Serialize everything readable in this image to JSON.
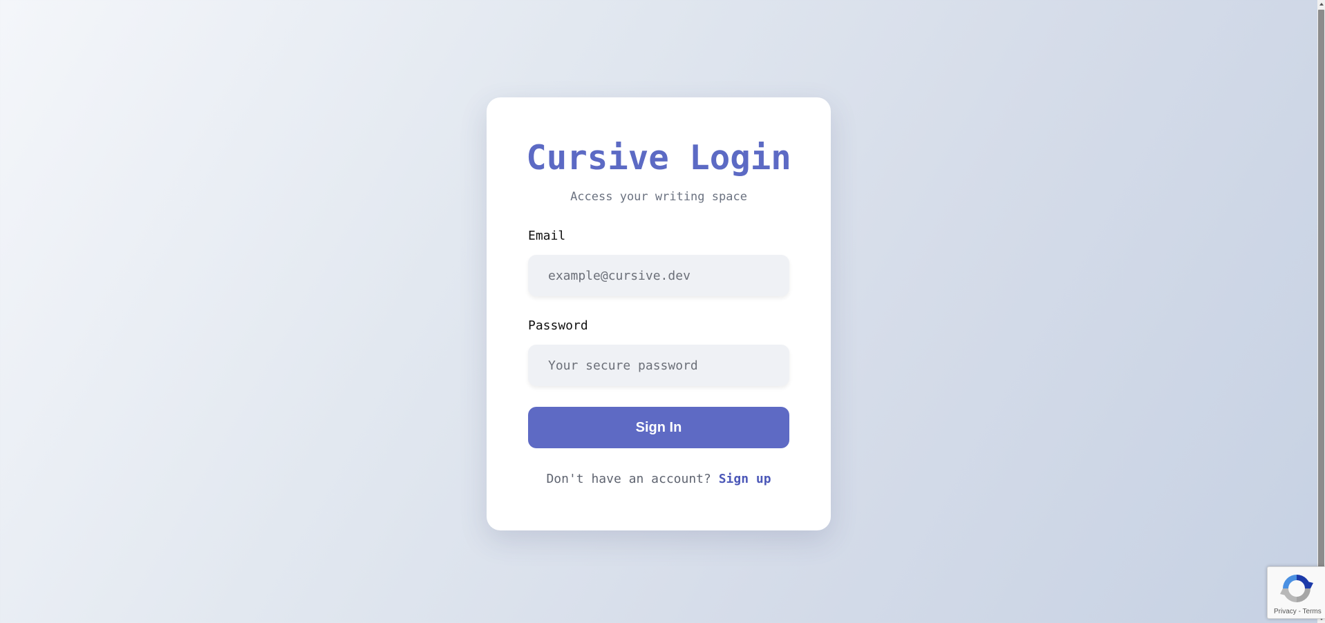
{
  "card": {
    "title": "Cursive Login",
    "subtitle": "Access your writing space"
  },
  "form": {
    "email_label": "Email",
    "email_placeholder": "example@cursive.dev",
    "email_value": "",
    "password_label": "Password",
    "password_placeholder": "Your secure password",
    "password_value": "",
    "submit_label": "Sign In"
  },
  "footer": {
    "prompt": "Don't have an account? ",
    "signup_link": "Sign up"
  },
  "recaptcha": {
    "privacy": "Privacy",
    "separator": " - ",
    "terms": "Terms"
  },
  "colors": {
    "accent": "#5c6ac4",
    "button": "#5e6ac4",
    "link": "#4c58b8",
    "card_background": "#ffffff",
    "input_background": "#eff1f5"
  },
  "icons": {
    "captcha": "recaptcha-logo-icon"
  }
}
